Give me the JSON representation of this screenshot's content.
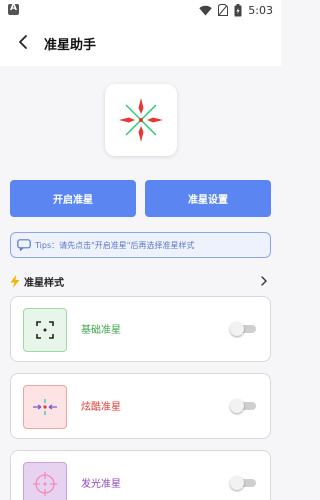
{
  "status_bar": {
    "time": "5:03"
  },
  "header": {
    "title": "准星助手"
  },
  "buttons": {
    "start": "开启准星",
    "settings": "准星设置"
  },
  "tips": {
    "text": "Tips：请先点击\"开启准星\"后再选择准星样式"
  },
  "section": {
    "title": "准星样式"
  },
  "styles": [
    {
      "label": "基础准星",
      "color": "#3fa34d",
      "thumb_bg": "#e7f6e9",
      "thumb_border": "#9fd9a6",
      "enabled": false
    },
    {
      "label": "炫酷准星",
      "color": "#e0403a",
      "thumb_bg": "#fde3e3",
      "thumb_border": "#f0a3a3",
      "enabled": false
    },
    {
      "label": "发光准星",
      "color": "#8e4bb8",
      "thumb_bg": "#efe0f6",
      "thumb_border": "#c9a3dd",
      "enabled": false
    }
  ],
  "colors": {
    "accent": "#5b86f2",
    "crosshair_red": "#e53935",
    "crosshair_green": "#2ecc71"
  }
}
